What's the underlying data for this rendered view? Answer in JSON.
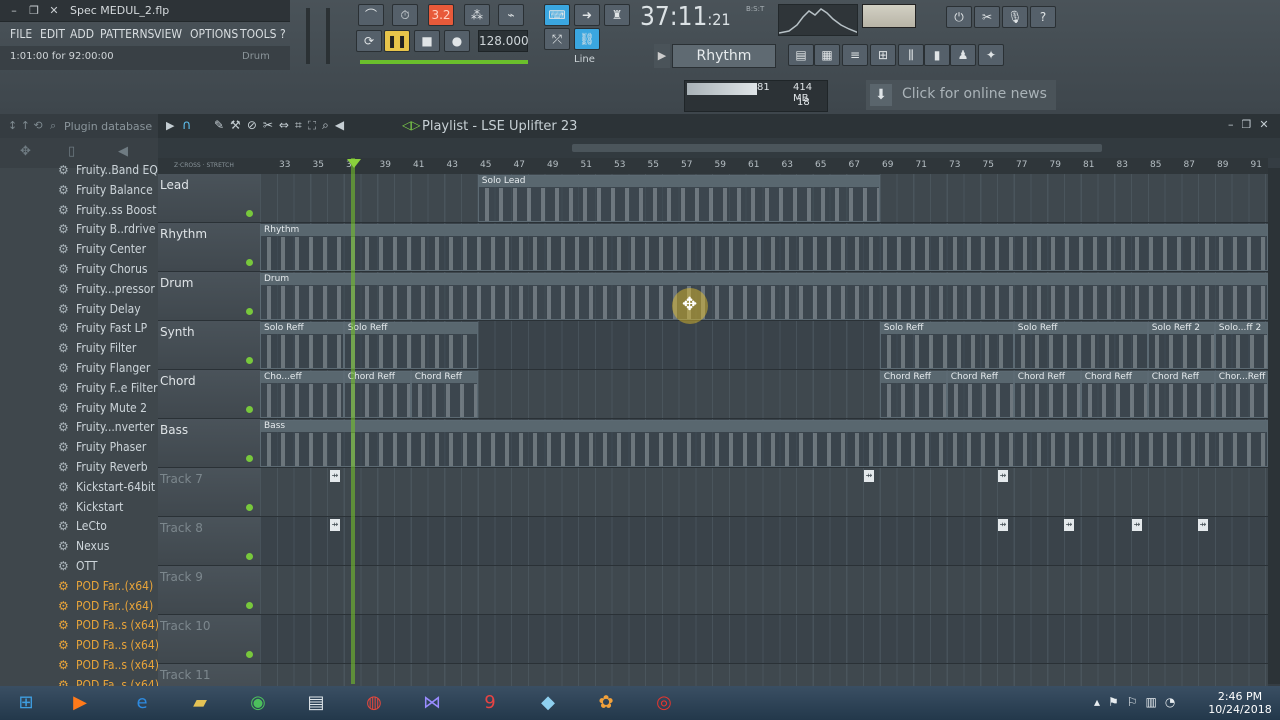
{
  "window": {
    "file_title": "Spec MEDUL_2.flp"
  },
  "menu": [
    "FILE",
    "EDIT",
    "ADD",
    "PATTERNS",
    "VIEW",
    "OPTIONS",
    "TOOLS",
    "?"
  ],
  "hint": {
    "text": "1:01:00 for 92:00:00",
    "right": "Drum"
  },
  "transport": {
    "tempo": "128.000",
    "time_main": "37:11",
    "time_sub": ":21",
    "bst": "B:S:T",
    "snap": "Line",
    "pattern": "Rhythm"
  },
  "memory": {
    "cpu": "81",
    "mem": "414 MB",
    "poly": "18"
  },
  "news": {
    "text": "Click for online news"
  },
  "browser": {
    "title": "Plugin database",
    "items": [
      {
        "label": "Fruity..Band EQ",
        "type": "fx"
      },
      {
        "label": "Fruity Balance",
        "type": "fx"
      },
      {
        "label": "Fruity..ss Boost",
        "type": "fx"
      },
      {
        "label": "Fruity B..rdrive",
        "type": "fx"
      },
      {
        "label": "Fruity Center",
        "type": "fx"
      },
      {
        "label": "Fruity Chorus",
        "type": "fx"
      },
      {
        "label": "Fruity...pressor",
        "type": "fx"
      },
      {
        "label": "Fruity Delay",
        "type": "fx"
      },
      {
        "label": "Fruity Fast LP",
        "type": "fx"
      },
      {
        "label": "Fruity Filter",
        "type": "fx"
      },
      {
        "label": "Fruity Flanger",
        "type": "fx"
      },
      {
        "label": "Fruity F..e Filter",
        "type": "fx"
      },
      {
        "label": "Fruity Mute 2",
        "type": "fx"
      },
      {
        "label": "Fruity...nverter",
        "type": "fx"
      },
      {
        "label": "Fruity Phaser",
        "type": "fx"
      },
      {
        "label": "Fruity Reverb",
        "type": "fx"
      },
      {
        "label": "Kickstart-64bit",
        "type": "fx"
      },
      {
        "label": "Kickstart",
        "type": "fx"
      },
      {
        "label": "LeCto",
        "type": "fx"
      },
      {
        "label": "Nexus",
        "type": "fx"
      },
      {
        "label": "OTT",
        "type": "fx"
      },
      {
        "label": "POD Far..(x64)",
        "type": "pod"
      },
      {
        "label": "POD Far..(x64)",
        "type": "pod"
      },
      {
        "label": "POD Fa..s (x64)",
        "type": "pod"
      },
      {
        "label": "POD Fa..s (x64)",
        "type": "pod"
      },
      {
        "label": "POD Fa..s (x64)",
        "type": "pod"
      },
      {
        "label": "POD Fa..s (x64)",
        "type": "pod"
      }
    ]
  },
  "playlist": {
    "title": "Playlist - LSE Uplifter 23",
    "ruler": [
      "33",
      "35",
      "37",
      "39",
      "41",
      "43",
      "45",
      "47",
      "49",
      "51",
      "53",
      "55",
      "57",
      "59",
      "61",
      "63",
      "65",
      "67",
      "69",
      "71",
      "73",
      "75",
      "77",
      "79",
      "81",
      "83",
      "85",
      "87",
      "89",
      "91"
    ],
    "tracks": [
      {
        "name": "Lead",
        "dim": false,
        "clips": [
          {
            "name": "Solo Lead",
            "start": 45,
            "end": 69
          }
        ]
      },
      {
        "name": "Rhythm",
        "dim": false,
        "clips": [
          {
            "name": "Rhythm",
            "start": 32,
            "end": 93
          }
        ]
      },
      {
        "name": "Drum",
        "dim": false,
        "clips": [
          {
            "name": "Drum",
            "start": 32,
            "end": 93
          }
        ]
      },
      {
        "name": "Synth",
        "dim": false,
        "clips": [
          {
            "name": "Solo Reff",
            "start": 32,
            "end": 37
          },
          {
            "name": "Solo Reff",
            "start": 37,
            "end": 45
          },
          {
            "name": "Solo Reff",
            "start": 69,
            "end": 77
          },
          {
            "name": "Solo Reff",
            "start": 77,
            "end": 85
          },
          {
            "name": "Solo Reff 2",
            "start": 85,
            "end": 89
          },
          {
            "name": "Solo...ff 2",
            "start": 89,
            "end": 93
          }
        ]
      },
      {
        "name": "Chord",
        "dim": false,
        "clips": [
          {
            "name": "Cho...eff",
            "start": 32,
            "end": 37
          },
          {
            "name": "Chord Reff",
            "start": 37,
            "end": 41
          },
          {
            "name": "Chord Reff",
            "start": 41,
            "end": 45
          },
          {
            "name": "Chord Reff",
            "start": 69,
            "end": 73
          },
          {
            "name": "Chord Reff",
            "start": 73,
            "end": 77
          },
          {
            "name": "Chord Reff",
            "start": 77,
            "end": 81
          },
          {
            "name": "Chord Reff",
            "start": 81,
            "end": 85
          },
          {
            "name": "Chord Reff",
            "start": 85,
            "end": 89
          },
          {
            "name": "Chor...Reff",
            "start": 89,
            "end": 93
          }
        ]
      },
      {
        "name": "Bass",
        "dim": false,
        "clips": [
          {
            "name": "Bass",
            "start": 32,
            "end": 93
          }
        ]
      },
      {
        "name": "Track 7",
        "dim": true,
        "clips": []
      },
      {
        "name": "Track 8",
        "dim": true,
        "clips": []
      },
      {
        "name": "Track 9",
        "dim": true,
        "clips": []
      },
      {
        "name": "Track 10",
        "dim": true,
        "clips": []
      },
      {
        "name": "Track 11",
        "dim": true,
        "clips": []
      }
    ]
  },
  "taskbar": {
    "time": "2:46 PM",
    "date": "10/24/2018"
  }
}
